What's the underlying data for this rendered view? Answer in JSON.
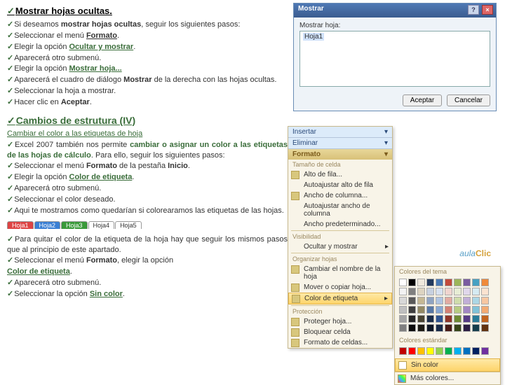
{
  "s1": {
    "title": "Mostrar hojas ocultas.",
    "p1a": "Si deseamos ",
    "p1b": "mostrar hojas ocultas",
    "p1c": ", seguir los siguientes pasos:",
    "p2a": "Seleccionar el menú ",
    "p2b": "Formato",
    "p2c": ".",
    "p3a": "Elegir la opción ",
    "p3b": "Ocultar y mostrar",
    "p3c": ".",
    "p4": "Aparecerá otro submenú.",
    "p5a": "Elegir la opción ",
    "p5b": "Mostrar hoja...",
    "p6a": "Aparecerá el cuadro de diálogo ",
    "p6b": "Mostrar",
    "p6c": " de la derecha con las hojas ocultas.",
    "p7": "Seleccionar la hoja a mostrar.",
    "p8a": "Hacer clic en ",
    "p8b": "Aceptar",
    "p8c": "."
  },
  "s2": {
    "title": "Cambios de estrutura (IV)",
    "sub": "Cambiar el color a las etiquetas de hoja",
    "p1a": "Excel 2007 también nos permite ",
    "p1b": "cambiar o asignar un color a las etiquetas de las hojas de cálculo",
    "p1c": ". Para ello, seguir los siguientes pasos:",
    "p2a": "Seleccionar el menú ",
    "p2b": "Formato",
    "p2c": " de la pestaña ",
    "p2d": "Inicio",
    "p2e": ".",
    "p3a": "Elegir la opción ",
    "p3b": "Color de etiqueta",
    "p3c": ".",
    "p4": "Aparecerá otro submenú.",
    "p5": "Seleccionar el color deseado.",
    "p6": "Aqui te mostramos como quedarían si colorearamos las etiquetas de las hojas."
  },
  "s3": {
    "p1": "Para quitar el color de la etiqueta de la hoja hay que seguir los mismos pasos que al principio de este apartado.",
    "p2a": "Seleccionar el menú ",
    "p2b": "Formato",
    "p2c": ", elegir la opción",
    "p3": "Color de etiqueta",
    "p4": "Aparecerá otro submenú.",
    "p5a": "Seleccionar la opción ",
    "p5b": "Sin color",
    "p5c": "."
  },
  "dlg": {
    "title": "Mostrar",
    "label": "Mostrar hoja:",
    "item": "Hoja1",
    "ok": "Aceptar",
    "cancel": "Cancelar"
  },
  "menu": {
    "top1": "Insertar",
    "top2": "Eliminar",
    "hdr": "Formato",
    "st1": "Tamaño de celda",
    "i1": "Alto de fila...",
    "i2": "Autoajustar alto de fila",
    "i3": "Ancho de columna...",
    "i4": "Autoajustar ancho de columna",
    "i5": "Ancho predeterminado...",
    "st2": "Visibilidad",
    "i6": "Ocultar y mostrar",
    "st3": "Organizar hojas",
    "i7": "Cambiar el nombre de la hoja",
    "i8": "Mover o copiar hoja...",
    "i9": "Color de etiqueta",
    "st4": "Protección",
    "i10": "Proteger hoja...",
    "i11": "Bloquear celda",
    "i12": "Formato de celdas..."
  },
  "pal": {
    "s1": "Colores del tema",
    "s2": "Colores estándar",
    "o1": "Sin color",
    "o2": "Más colores..."
  },
  "tabs": {
    "t1": "Hoja1",
    "t2": "Hoja2",
    "t3": "Hoja3",
    "t4": "Hoja4",
    "t5": "Hoja5"
  },
  "logo": {
    "a": "aula",
    "b": "Clic"
  },
  "colors": {
    "theme": [
      [
        "#fff",
        "#000",
        "#eee8dc",
        "#223a5e",
        "#4a7ab5",
        "#c24a3b",
        "#9cb55a",
        "#7a5ca0",
        "#46a1c2",
        "#ef8a3a"
      ],
      [
        "#f2f2f2",
        "#7f7f7f",
        "#ddd4c0",
        "#c7d1e0",
        "#d7e1f0",
        "#f0d5d0",
        "#e7edd5",
        "#e0d7eb",
        "#d5ebf2",
        "#fbe3d0"
      ],
      [
        "#d8d8d8",
        "#595959",
        "#c5b894",
        "#8fa4c2",
        "#afc4e1",
        "#e2aba2",
        "#cfdcab",
        "#c1afd7",
        "#abd7e5",
        "#f7c7a1"
      ],
      [
        "#bfbfbf",
        "#3f3f3f",
        "#948a65",
        "#5778a6",
        "#87a7d2",
        "#d48174",
        "#b7cb81",
        "#a287c3",
        "#81c3d8",
        "#f3ab72"
      ],
      [
        "#a5a5a5",
        "#262626",
        "#4a4533",
        "#1b2d4a",
        "#2e5490",
        "#8f3528",
        "#6e8a33",
        "#563b85",
        "#2a7d99",
        "#c2641e"
      ],
      [
        "#7f7f7f",
        "#0c0c0c",
        "#1d1b14",
        "#0d1625",
        "#172a48",
        "#471a14",
        "#374519",
        "#2b1d42",
        "#153e4c",
        "#61320f"
      ]
    ],
    "std": [
      "#c00000",
      "#ff0000",
      "#ffc000",
      "#ffff00",
      "#92d050",
      "#00b050",
      "#00b0f0",
      "#0070c0",
      "#002060",
      "#7030a0"
    ]
  }
}
